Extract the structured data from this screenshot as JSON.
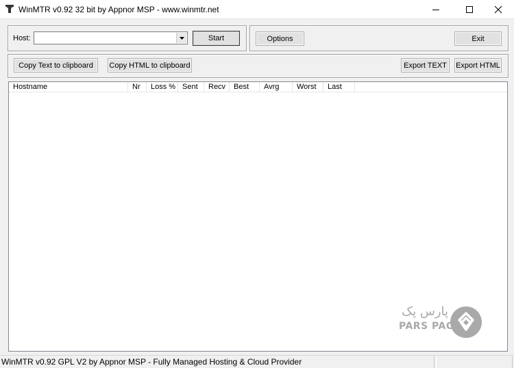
{
  "window": {
    "title": "WinMTR v0.92 32 bit by Appnor MSP - www.winmtr.net",
    "icons": [
      "app-icon",
      "minimize-icon",
      "maximize-icon",
      "close-icon"
    ]
  },
  "host_group": {
    "host_label": "Host:",
    "host_value": "",
    "start_label": "Start"
  },
  "options_group": {
    "options_label": "Options",
    "exit_label": "Exit"
  },
  "export_group": {
    "copy_text_label": "Copy Text to clipboard",
    "copy_html_label": "Copy HTML to clipboard",
    "export_text_label": "Export TEXT",
    "export_html_label": "Export HTML"
  },
  "table": {
    "columns": [
      "Hostname",
      "Nr",
      "Loss %",
      "Sent",
      "Recv",
      "Best",
      "Avrg",
      "Worst",
      "Last"
    ],
    "rows": []
  },
  "statusbar": {
    "text": "WinMTR v0.92 GPL V2 by Appnor MSP - Fully Managed Hosting & Cloud Provider"
  },
  "watermark": {
    "arabic": "پارس پک",
    "latin": "PARS PACK",
    "color": "#a9a9a9"
  }
}
